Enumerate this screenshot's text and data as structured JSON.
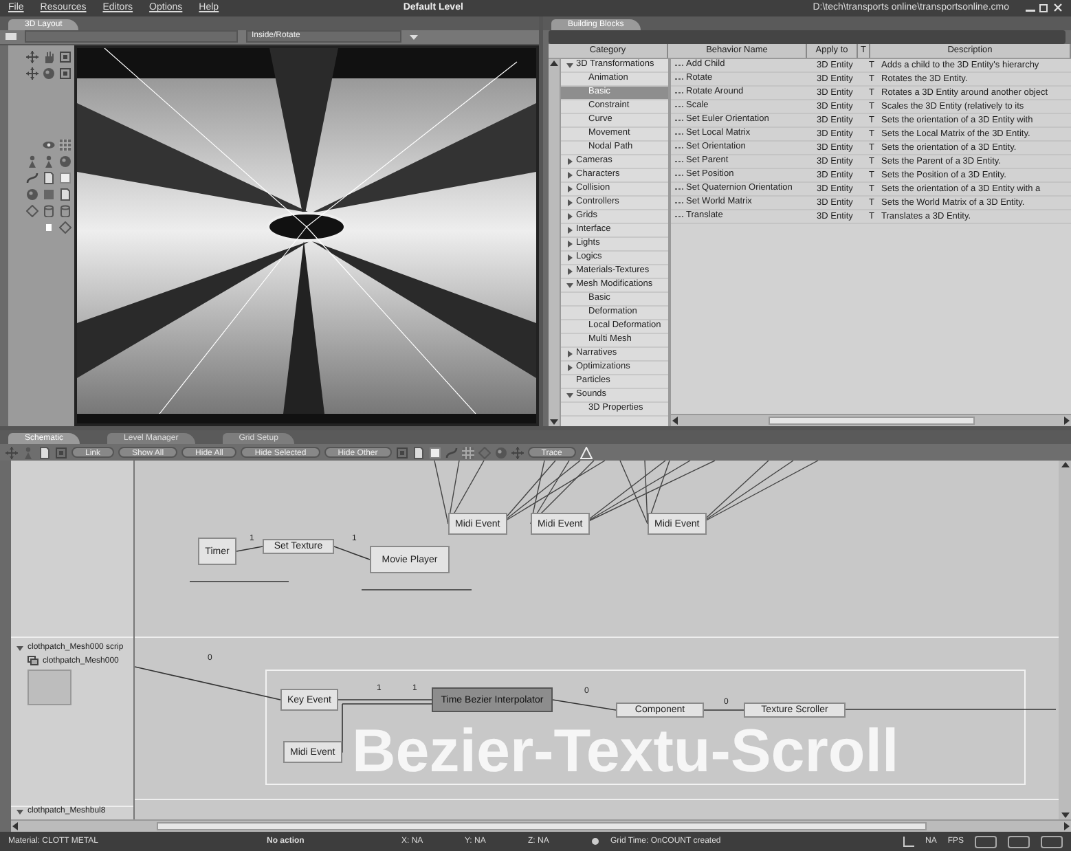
{
  "menu_bar": {
    "items": [
      "File",
      "Resources",
      "Editors",
      "Options",
      "Help"
    ],
    "title": "Default Level",
    "file_path": "D:\\tech\\transports online\\transportsonline.cmo"
  },
  "layout_panel": {
    "tab": {
      "label": "3D Layout",
      "selected": true
    },
    "view_dropdown": {
      "value": "Inside/Rotate"
    }
  },
  "building_blocks": {
    "tab": {
      "label": "Building Blocks",
      "selected": true
    },
    "columns": [
      "Category",
      "Behavior Name",
      "Apply to",
      "T",
      "Description"
    ],
    "categories": [
      {
        "label": "3D Transformations",
        "kind": "group",
        "expanded": true,
        "selected": false,
        "children": [
          {
            "label": "Animation",
            "selected": false
          },
          {
            "label": "Basic",
            "selected": true
          },
          {
            "label": "Constraint",
            "selected": false
          },
          {
            "label": "Curve",
            "selected": false
          },
          {
            "label": "Movement",
            "selected": false
          },
          {
            "label": "Nodal Path",
            "selected": false
          }
        ]
      },
      {
        "label": "Cameras",
        "kind": "group",
        "expanded": false,
        "selected": false
      },
      {
        "label": "Characters",
        "kind": "group",
        "expanded": false,
        "selected": false
      },
      {
        "label": "Collision",
        "kind": "group",
        "expanded": false,
        "selected": false
      },
      {
        "label": "Controllers",
        "kind": "group",
        "expanded": false,
        "selected": false
      },
      {
        "label": "Grids",
        "kind": "group",
        "expanded": false,
        "selected": false
      },
      {
        "label": "Interface",
        "kind": "group",
        "expanded": false,
        "selected": false
      },
      {
        "label": "Lights",
        "kind": "group",
        "expanded": false,
        "selected": false
      },
      {
        "label": "Logics",
        "kind": "group",
        "expanded": false,
        "selected": false
      },
      {
        "label": "Materials-Textures",
        "kind": "group",
        "expanded": false,
        "selected": false
      },
      {
        "label": "Mesh Modifications",
        "kind": "group",
        "expanded": true,
        "selected": false,
        "children": [
          {
            "label": "Basic",
            "selected": false
          },
          {
            "label": "Deformation",
            "selected": false
          },
          {
            "label": "Local Deformation",
            "selected": false
          },
          {
            "label": "Multi Mesh",
            "selected": false
          }
        ]
      },
      {
        "label": "Narratives",
        "kind": "group",
        "expanded": false,
        "selected": false
      },
      {
        "label": "Optimizations",
        "kind": "group",
        "expanded": false,
        "selected": false
      },
      {
        "label": "Particles",
        "kind": "leaf",
        "selected": false
      },
      {
        "label": "Sounds",
        "kind": "group",
        "expanded": true,
        "selected": false,
        "children": [
          {
            "label": "3D Properties",
            "selected": false
          }
        ]
      }
    ],
    "behaviors": [
      {
        "name": "Add Child",
        "apply_to": "3D Entity",
        "type": "T",
        "description": "Adds a child to the 3D Entity's hierarchy"
      },
      {
        "name": "Rotate",
        "apply_to": "3D Entity",
        "type": "T",
        "description": "Rotates the 3D Entity."
      },
      {
        "name": "Rotate Around",
        "apply_to": "3D Entity",
        "type": "T",
        "description": "Rotates a 3D Entity around another object"
      },
      {
        "name": "Scale",
        "apply_to": "3D Entity",
        "type": "T",
        "description": "Scales the 3D Entity (relatively to its"
      },
      {
        "name": "Set Euler Orientation",
        "apply_to": "3D Entity",
        "type": "T",
        "description": "Sets the orientation of a 3D Entity with"
      },
      {
        "name": "Set Local Matrix",
        "apply_to": "3D Entity",
        "type": "T",
        "description": "Sets the Local Matrix of the 3D Entity."
      },
      {
        "name": "Set Orientation",
        "apply_to": "3D Entity",
        "type": "T",
        "description": "Sets the orientation of a 3D Entity."
      },
      {
        "name": "Set Parent",
        "apply_to": "3D Entity",
        "type": "T",
        "description": "Sets the Parent of a 3D Entity."
      },
      {
        "name": "Set Position",
        "apply_to": "3D Entity",
        "type": "T",
        "description": "Sets the Position of a 3D Entity."
      },
      {
        "name": "Set Quaternion Orientation",
        "apply_to": "3D Entity",
        "type": "T",
        "description": "Sets the orientation of a 3D Entity with a"
      },
      {
        "name": "Set World Matrix",
        "apply_to": "3D Entity",
        "type": "T",
        "description": "Sets the World Matrix of a 3D Entity."
      },
      {
        "name": "Translate",
        "apply_to": "3D Entity",
        "type": "T",
        "description": "Translates a 3D Entity."
      }
    ]
  },
  "schematic": {
    "tabs": [
      {
        "label": "Schematic",
        "selected": true
      },
      {
        "label": "Level Manager",
        "selected": false
      },
      {
        "label": "Grid Setup",
        "selected": false
      }
    ],
    "toolbar_buttons": [
      "Link",
      "Show All",
      "Hide All",
      "Hide Selected",
      "Hide Other",
      "Trace"
    ],
    "scripts": [
      {
        "title": "clothpatch_Mesh000 scrip",
        "expanded": true,
        "object": "clothpatch_Mesh000"
      },
      {
        "title": "clothpatch_Meshbul8",
        "expanded": true
      }
    ],
    "nodes": [
      {
        "label": "Midi Event",
        "selected": false
      },
      {
        "label": "Midi Event",
        "selected": false
      },
      {
        "label": "Midi Event",
        "selected": false
      },
      {
        "label": "Timer",
        "selected": false
      },
      {
        "label": "Set Texture",
        "selected": false
      },
      {
        "label": "Movie Player",
        "selected": false
      },
      {
        "label": "Key Event",
        "selected": false
      },
      {
        "label": "Midi Event",
        "selected": false
      },
      {
        "label": "Time Bezier Interpolator",
        "selected": true
      },
      {
        "label": "Component",
        "selected": false
      },
      {
        "label": "Texture Scroller",
        "selected": false
      }
    ],
    "links": [
      {
        "label": "1"
      },
      {
        "label": "1"
      },
      {
        "label": "0"
      },
      {
        "label": "1"
      },
      {
        "label": "1"
      },
      {
        "label": "0"
      },
      {
        "label": "0"
      }
    ],
    "comment": "Bezier-Textu-Scroll"
  },
  "status_bar": {
    "material": "Material: CLOTT METAL",
    "action": "No action",
    "x": "X: NA",
    "y": "Y: NA",
    "z": "Z: NA",
    "message": "Grid Time: OnCOUNT created",
    "fps_value": "NA",
    "fps_label": "FPS"
  }
}
